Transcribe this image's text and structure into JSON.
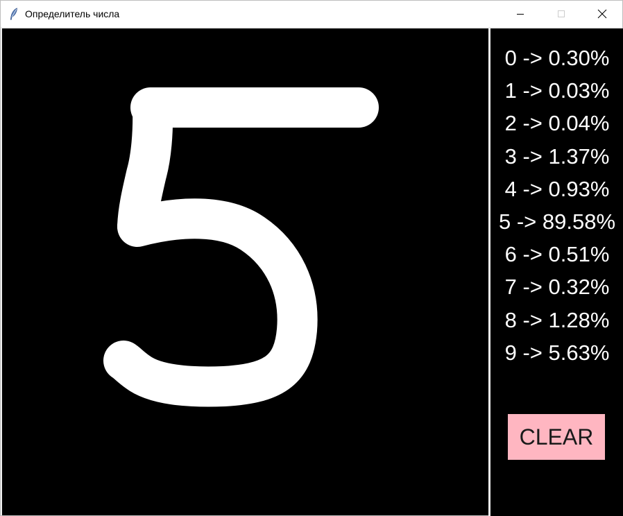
{
  "window": {
    "title": "Определитель числа",
    "icon": "feather-icon",
    "controls": [
      "minimize-icon",
      "maximize-icon",
      "close-icon"
    ]
  },
  "canvas": {
    "background": "#000000",
    "stroke_color": "#ffffff",
    "drawn_digit": "5"
  },
  "predictions": [
    {
      "label": "0 -> 0.30%"
    },
    {
      "label": "1 -> 0.03%"
    },
    {
      "label": "2 -> 0.04%"
    },
    {
      "label": "3 -> 1.37%"
    },
    {
      "label": "4 -> 0.93%"
    },
    {
      "label": "5 -> 89.58%"
    },
    {
      "label": "6 -> 0.51%"
    },
    {
      "label": "7 -> 0.32%"
    },
    {
      "label": "8 -> 1.28%"
    },
    {
      "label": "9 -> 5.63%"
    }
  ],
  "clear_button": {
    "label": "CLEAR",
    "color": "#ffb6c1"
  }
}
